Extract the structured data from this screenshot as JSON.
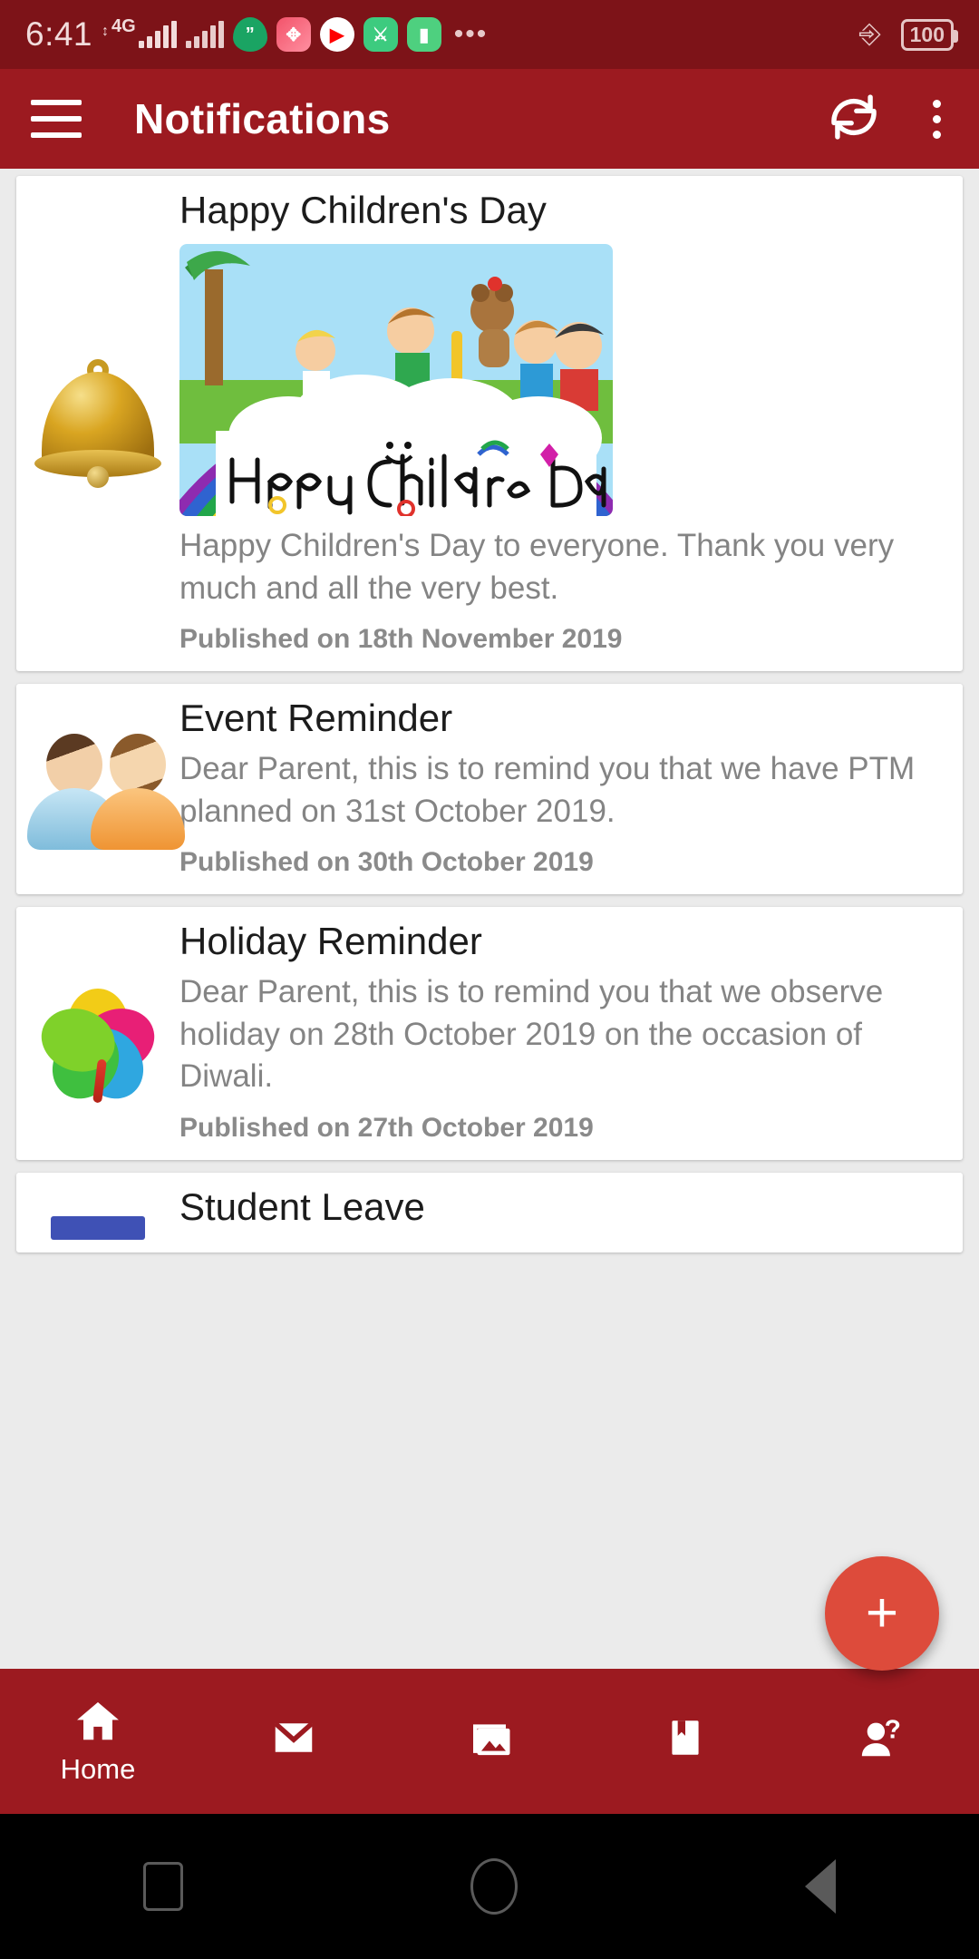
{
  "status_bar": {
    "time": "6:41",
    "network_type": "4G",
    "battery_level": "100",
    "overflow_dots": "•••",
    "icons": [
      "signal-bars-sim1-icon",
      "signal-bars-sim2-icon",
      "quote-app-icon",
      "fitness-app-icon",
      "youtube-app-icon",
      "green-app-icon",
      "chat-app-icon",
      "vibrate-icon",
      "battery-icon"
    ]
  },
  "app_bar": {
    "title": "Notifications",
    "menu_icon": "hamburger-menu-icon",
    "refresh_icon": "refresh-icon",
    "overflow_icon": "more-vertical-icon",
    "background_color": "#9c1a20"
  },
  "notifications": [
    {
      "icon": "bell-icon",
      "title": "Happy Children's Day",
      "has_image": true,
      "image_alt": "Happy Children Day banner with rainbow and children",
      "description": "Happy Children's Day to everyone. Thank you very much and all the very best.",
      "published": "Published on 18th November 2019"
    },
    {
      "icon": "parents-icon",
      "title": "Event Reminder",
      "has_image": false,
      "description": "Dear Parent, this is to remind you that we have PTM planned on 31st October 2019.",
      "published": "Published on 30th October 2019"
    },
    {
      "icon": "flower-icon",
      "title": "Holiday Reminder",
      "has_image": false,
      "description": "Dear Parent, this is to remind you that we observe holiday on 28th October 2019 on the occasion of Diwali.",
      "published": "Published on 27th October 2019"
    },
    {
      "icon": "blue-bar-icon",
      "title": "Student Leave",
      "has_image": false,
      "description": "",
      "published": ""
    }
  ],
  "fab": {
    "label": "+",
    "icon": "plus-icon",
    "color": "#dd4b3b"
  },
  "bottom_nav": {
    "items": [
      {
        "icon": "home-icon",
        "label": "Home",
        "active": true
      },
      {
        "icon": "mail-icon",
        "label": "",
        "active": false
      },
      {
        "icon": "gallery-icon",
        "label": "",
        "active": false
      },
      {
        "icon": "bookmark-icon",
        "label": "",
        "active": false
      },
      {
        "icon": "person-help-icon",
        "label": "",
        "active": false
      }
    ]
  },
  "android_nav": {
    "recents": "square-recents-icon",
    "home": "circle-home-icon",
    "back": "triangle-back-icon"
  }
}
